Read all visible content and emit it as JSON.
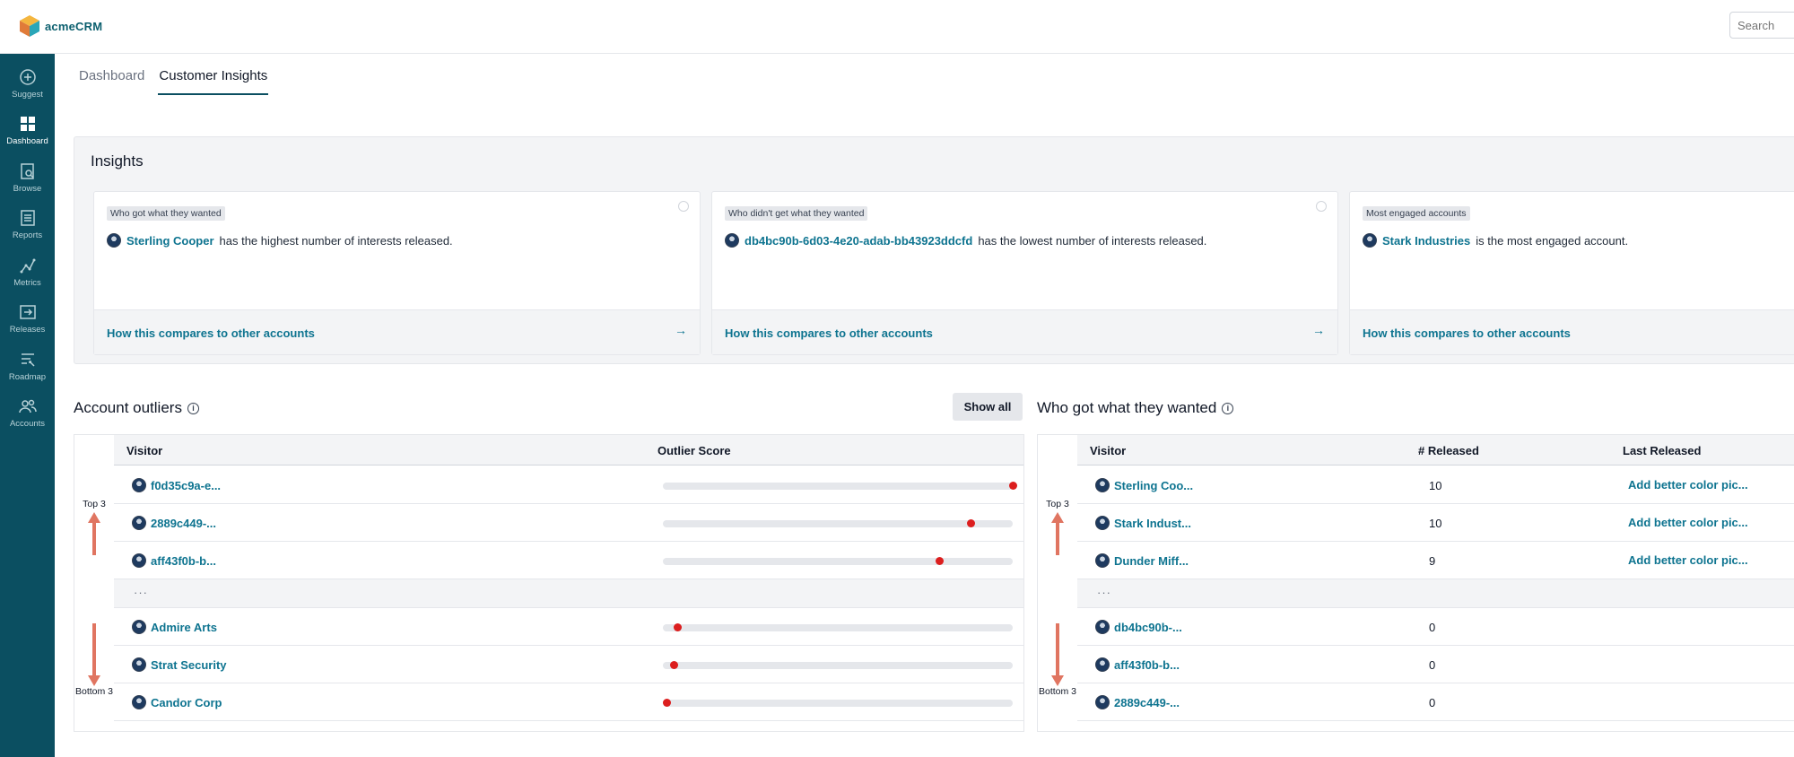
{
  "app": {
    "logo_text": "acmeCRM"
  },
  "search": {
    "placeholder": "Search"
  },
  "sidebar": {
    "items": [
      {
        "label": "Suggest",
        "icon": "plus-circle-icon",
        "active": false
      },
      {
        "label": "Dashboard",
        "icon": "grid-icon",
        "active": true
      },
      {
        "label": "Browse",
        "icon": "browse-icon",
        "active": false
      },
      {
        "label": "Reports",
        "icon": "reports-icon",
        "active": false
      },
      {
        "label": "Metrics",
        "icon": "metrics-icon",
        "active": false
      },
      {
        "label": "Releases",
        "icon": "releases-icon",
        "active": false
      },
      {
        "label": "Roadmap",
        "icon": "roadmap-icon",
        "active": false
      },
      {
        "label": "Accounts",
        "icon": "accounts-icon",
        "active": false
      }
    ]
  },
  "tabs": [
    {
      "label": "Dashboard",
      "active": false
    },
    {
      "label": "Customer Insights",
      "active": true
    }
  ],
  "insights": {
    "title": "Insights",
    "cards": [
      {
        "tag": "Who got what they wanted",
        "name": "Sterling Cooper",
        "text": "has the highest number of interests released.",
        "link": "How this compares to other accounts"
      },
      {
        "tag": "Who didn't get what they wanted",
        "name": "db4bc90b-6d03-4e20-adab-bb43923ddcfd",
        "text": "has the lowest number of interests released.",
        "link": "How this compares to other accounts"
      },
      {
        "tag": "Most engaged accounts",
        "name": "Stark Industries",
        "text": "is the most engaged account.",
        "link": "How this compares to other accounts"
      }
    ]
  },
  "outliers": {
    "title": "Account outliers",
    "show_all": "Show all",
    "col_visitor": "Visitor",
    "col_score": "Outlier Score",
    "top_label": "Top 3",
    "bottom_label": "Bottom 3",
    "ellipsis": "···",
    "top_rows": [
      {
        "name": "f0d35c9a-e...",
        "score": 1.0
      },
      {
        "name": "2889c449-...",
        "score": 0.88
      },
      {
        "name": "aff43f0b-b...",
        "score": 0.79
      }
    ],
    "bottom_rows": [
      {
        "name": "Admire Arts",
        "score": 0.04
      },
      {
        "name": "Strat Security",
        "score": 0.03
      },
      {
        "name": "Candor Corp",
        "score": 0.01
      }
    ]
  },
  "wanted": {
    "title": "Who got what they wanted",
    "col_visitor": "Visitor",
    "col_released": "# Released",
    "col_last": "Last Released",
    "top_label": "Top 3",
    "bottom_label": "Bottom 3",
    "ellipsis": "···",
    "top_rows": [
      {
        "name": "Sterling Coo...",
        "released": "10",
        "last": "Add better color pic..."
      },
      {
        "name": "Stark Indust...",
        "released": "10",
        "last": "Add better color pic..."
      },
      {
        "name": "Dunder Miff...",
        "released": "9",
        "last": "Add better color pic..."
      }
    ],
    "bottom_rows": [
      {
        "name": "db4bc90b-...",
        "released": "0",
        "last": ""
      },
      {
        "name": "aff43f0b-b...",
        "released": "0",
        "last": ""
      },
      {
        "name": "2889c449-...",
        "released": "0",
        "last": ""
      }
    ]
  }
}
